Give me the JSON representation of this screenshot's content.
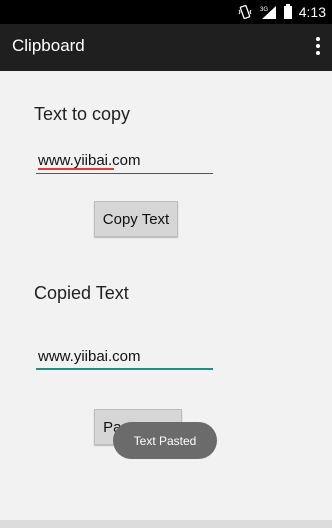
{
  "status_bar": {
    "time": "4:13",
    "icons": [
      "vibrate-icon",
      "signal-3g-icon",
      "battery-icon"
    ],
    "network_label": "3G"
  },
  "action_bar": {
    "title": "Clipboard",
    "menu_icon": "overflow-menu-icon"
  },
  "main": {
    "copy_section_label": "Text to copy",
    "copy_field_value": "www.yiibai.com",
    "copy_button_label": "Copy Text",
    "copied_section_label": "Copied Text",
    "copied_field_value": "www.yiibai.com",
    "paste_button_label": "Paste Text"
  },
  "toast": {
    "message": "Text Pasted"
  },
  "colors": {
    "accent": "#1e9088",
    "spellcheck": "#e53935",
    "action_bar": "#1f1f1f"
  }
}
